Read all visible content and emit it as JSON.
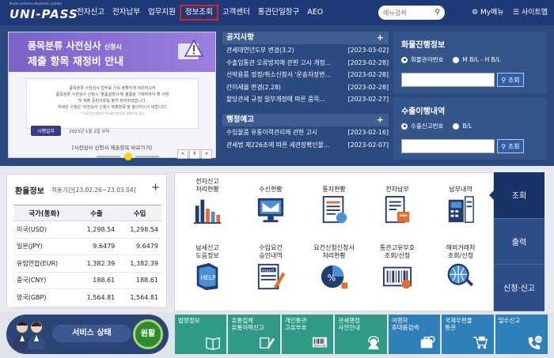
{
  "header": {
    "logo_sub": "Korea customs electronic system",
    "logo": "UNI-PASS",
    "nav": [
      "전자신고",
      "전자납부",
      "업무지원",
      "정보조회",
      "고객센터",
      "통관단일창구",
      "AEO"
    ],
    "active_nav": "정보조회",
    "search_placeholder": "메뉴검색",
    "my_menu": "My메뉴",
    "sitemap": "사이트맵"
  },
  "banner": {
    "title_line1": "품목분류 사전심사",
    "title_line1_small": "신청시",
    "title_line2": "제출 항목 재정비 안내",
    "body": [
      "품목분류 사전심사 업무를 신속·정확하게 처리하고자",
      "품목분류 사전심사 신청시 '물품설명서'에 물품을 기재하여야 할 사항",
      "및 제출 증빙서류를 붙여 정비하였습니다.",
      "자세한 사항은 '사전심사 신청시 제출항목'을 참고하시기 바랍니다."
    ],
    "body_note": "* 자료작성 방법은 관세평가분류원 홈페이지 참조",
    "date_label": "시행일자",
    "date_value": "2023년 1월 2일 부터",
    "caption": "[사전심사 신청서 제출항목 바로가기]",
    "ctrl_prev": "<",
    "ctrl_pause": "II",
    "ctrl_next": ">"
  },
  "notice": {
    "title": "공지사항",
    "plus": "+",
    "rows": [
      {
        "title": "관세대연년도부 변경(3.2)",
        "date": "[2023-03-02]"
      },
      {
        "title": "수출입통관 오류방지에 관한 고시 개정...",
        "date": "[2023-02-28]"
      },
      {
        "title": "선박용품 정정/취소신청서 '운송자장변...",
        "date": "[2023-02-28]"
      },
      {
        "title": "간이세율 변경(2.28)",
        "date": "[2023-02-28]"
      },
      {
        "title": "할당관세 규정 일부개정에 따른 품목...",
        "date": "[2023-02-27]"
      }
    ]
  },
  "admin_notice": {
    "title": "행정예고",
    "plus": "+",
    "rows": [
      {
        "title": "수입물품 유통이력관리에 관한 고시",
        "date": "[2023-02-16]"
      },
      {
        "title": "관세법 제226조에 따른 세관장확인물...",
        "date": "[2023-02-07]"
      }
    ]
  },
  "cargo": {
    "title": "화물진행정보",
    "options": [
      "화물관리번호",
      "M B/L - H B/L"
    ],
    "selected": "화물관리번호",
    "button": "조회"
  },
  "export": {
    "title": "수출이행내역",
    "options": [
      "수출신고번호",
      "B/L"
    ],
    "selected": "수출신고번호",
    "button": "조회"
  },
  "rates": {
    "title": "환율정보",
    "period": "적용기간[23.02.26~23.03.04]",
    "plus": "+",
    "headers": [
      "국가(통화)",
      "수출",
      "수입"
    ],
    "rows": [
      [
        "미국(USD)",
        "1,298.54",
        "1,298.54"
      ],
      [
        "일본(JPY)",
        "9.6479",
        "9.6479"
      ],
      [
        "유럽연합(EUR)",
        "1,382.39",
        "1,382.39"
      ],
      [
        "중국(CNY)",
        "188.61",
        "188.61"
      ],
      [
        "영국(GBP)",
        "1,564.81",
        "1,564.81"
      ]
    ]
  },
  "services": [
    {
      "label": "전자신고\n처리현황",
      "icon": "bar-chart-icon"
    },
    {
      "label": "수신현황",
      "icon": "mail-monitor-icon"
    },
    {
      "label": "통지현황",
      "icon": "document-notice-icon"
    },
    {
      "label": "전자납부",
      "icon": "document-pay-icon"
    },
    {
      "label": "납부내역",
      "icon": "receipt-icon"
    },
    {
      "label": "납세신고\n도움정보",
      "icon": "help-book-icon"
    },
    {
      "label": "수입요건\n승인내역",
      "icon": "import-document-icon"
    },
    {
      "label": "요건신청신청서\n처리현황",
      "icon": "percent-pie-icon"
    },
    {
      "label": "통관고유부호\n조회/신청",
      "icon": "barcode-id-icon"
    },
    {
      "label": "해외거래처\n조회/신청",
      "icon": "globe-search-icon"
    }
  ],
  "vtabs": [
    "조회",
    "출력",
    "신청·신고"
  ],
  "active_vtab": "조회",
  "status": {
    "label": "서비스 상태",
    "badge": "원활"
  },
  "quick": [
    {
      "label": "법령정보",
      "color": "#2f9a86",
      "icon": "book-icon"
    },
    {
      "label": "유통업체\n유통이력신고",
      "color": "#2f9a86",
      "icon": "pen-icon"
    },
    {
      "label": "개인통관\n고유부호",
      "color": "#2f9a86",
      "icon": "barcode-icon"
    },
    {
      "label": "관세행정\n사전안내",
      "color": "#2f9a86",
      "icon": "headset-icon"
    },
    {
      "label": "여행자\n휴대품검색",
      "color": "#2f7fb8",
      "icon": "suitcase-icon"
    },
    {
      "label": "국제우편물\n통관",
      "color": "#2f7fb8",
      "icon": "cart-icon"
    },
    {
      "label": "밀수신고",
      "color": "#2f7fb8",
      "icon": "phone-24h-icon"
    }
  ]
}
